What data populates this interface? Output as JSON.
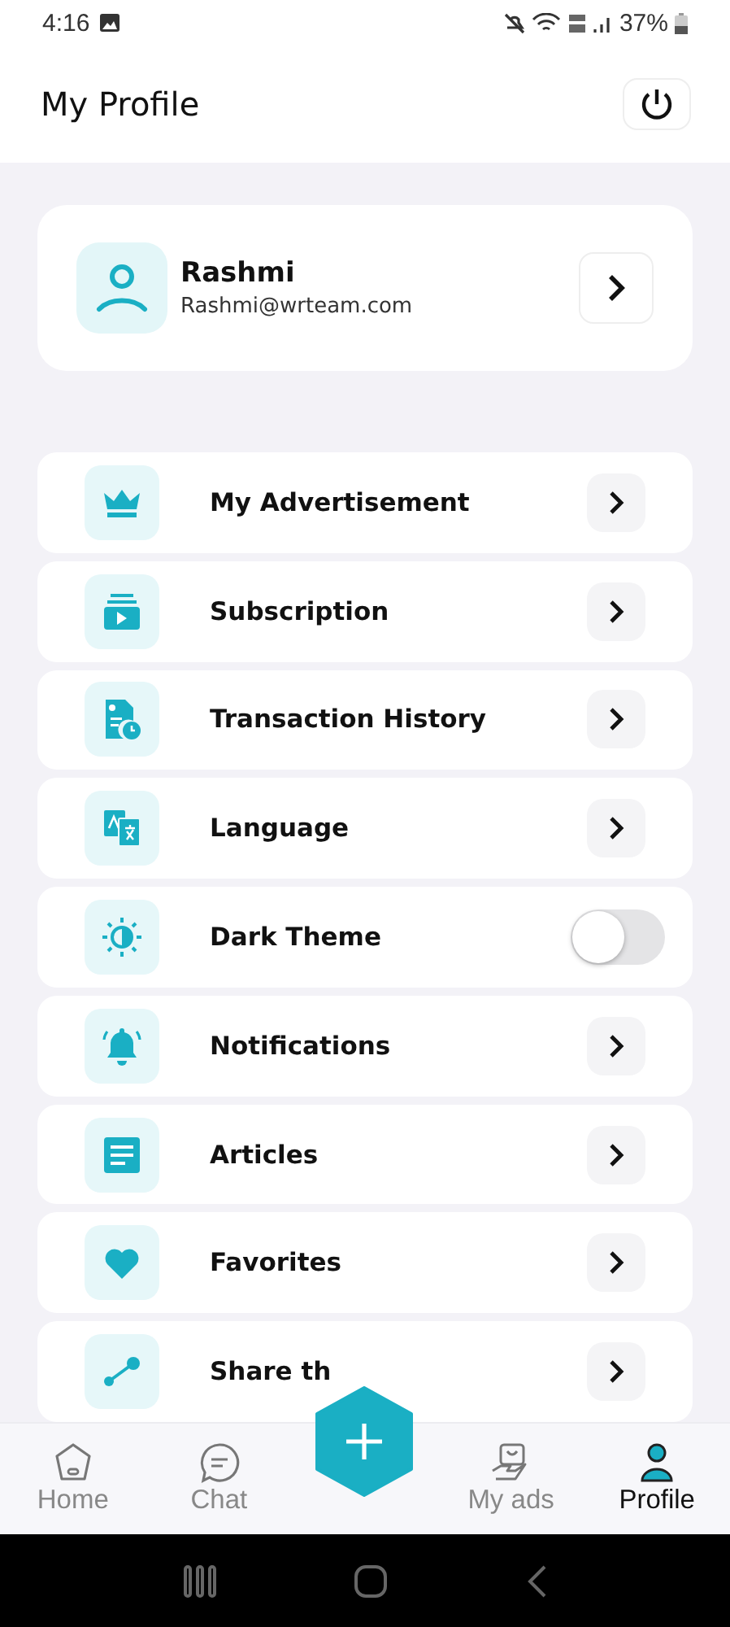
{
  "status_bar": {
    "time": "4:16",
    "battery": "37%"
  },
  "header": {
    "title": "My Profile"
  },
  "profile": {
    "name": "Rashmi",
    "email": "Rashmi@wrteam.com"
  },
  "menu": [
    {
      "kind": "link",
      "label": "My Advertisement"
    },
    {
      "kind": "link",
      "label": "Subscription"
    },
    {
      "kind": "link",
      "label": "Transaction History"
    },
    {
      "kind": "link",
      "label": "Language"
    },
    {
      "kind": "toggle",
      "label": "Dark Theme",
      "on": false
    },
    {
      "kind": "link",
      "label": "Notifications"
    },
    {
      "kind": "link",
      "label": "Articles"
    },
    {
      "kind": "link",
      "label": "Favorites"
    },
    {
      "kind": "link",
      "label": "Share th"
    }
  ],
  "bottom_nav": [
    {
      "kind": "tab",
      "label": "Home",
      "selected": false
    },
    {
      "kind": "tab",
      "label": "Chat",
      "selected": false
    },
    {
      "kind": "add"
    },
    {
      "kind": "tab",
      "label": "My ads",
      "selected": false
    },
    {
      "kind": "tab",
      "label": "Profile",
      "selected": true
    }
  ]
}
